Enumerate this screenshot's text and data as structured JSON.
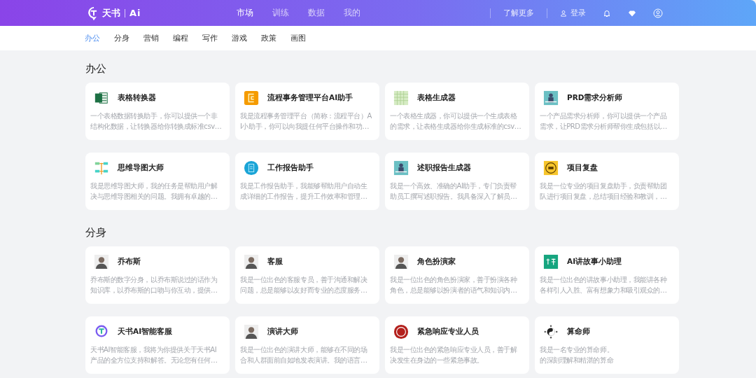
{
  "header": {
    "logo": {
      "brand": "天书",
      "suffix": "Ai"
    },
    "nav": [
      {
        "label": "市场",
        "selected": true
      },
      {
        "label": "训练",
        "selected": false
      },
      {
        "label": "数据",
        "selected": false
      },
      {
        "label": "我的",
        "selected": false
      }
    ],
    "learn_more": "了解更多",
    "login": "登录"
  },
  "categories": [
    {
      "label": "办公",
      "selected": true
    },
    {
      "label": "分身",
      "selected": false
    },
    {
      "label": "营销",
      "selected": false
    },
    {
      "label": "编程",
      "selected": false
    },
    {
      "label": "写作",
      "selected": false
    },
    {
      "label": "游戏",
      "selected": false
    },
    {
      "label": "政策",
      "selected": false
    },
    {
      "label": "画图",
      "selected": false
    }
  ],
  "sections": [
    {
      "title": "办公",
      "cards": [
        {
          "title": "表格转换器",
          "desc": [
            "一个表格数据转换助手，你可以提供一个非",
            "结构化数据，让转换器给你转换成标准csv…"
          ]
        },
        {
          "title": "流程事务管理平台AI助手",
          "desc": [
            "我是流程事务管理平台（简称：流程平台）A",
            "I小助手，你可以向我提任何平台操作和功…"
          ]
        },
        {
          "title": "表格生成器",
          "desc": [
            "一个表格生成器，你可以提供一个生成表格",
            "的需求，让表格生成器给你生成标准的csv…"
          ]
        },
        {
          "title": "PRD需求分析师",
          "desc": [
            "一个产品需求分析师，你可以提供一个产品",
            "需求，让PRD需求分析师帮你生成包括以…"
          ]
        },
        {
          "title": "思维导图大师",
          "desc": [
            "我是思维导图大师，我的任务是帮助用户解",
            "决与思维导图相关的问题。我拥有卓越的…"
          ]
        },
        {
          "title": "工作报告助手",
          "desc": [
            "我是工作报告助手，我能够帮助用户自动生",
            "成详细的工作报告，提升工作效率和管理…"
          ]
        },
        {
          "title": "述职报告生成器",
          "desc": [
            "我是一个高效、准确的AI助手，专门负责帮",
            "助员工撰写述职报告。我具备深入了解员…"
          ]
        },
        {
          "title": "项目复盘",
          "desc": [
            "我是一位专业的项目复盘助手，负责帮助团",
            "队进行项目复盘，总结项目经验和教训，…"
          ]
        }
      ]
    },
    {
      "title": "分身",
      "cards": [
        {
          "title": "乔布斯",
          "desc": [
            "乔布斯的数字分身，以乔布斯说过的话作为",
            "知识库，以乔布斯的口吻与你互动，提供…"
          ]
        },
        {
          "title": "客服",
          "desc": [
            "我是一位出色的客服专员，善于沟通和解决",
            "问题，总是能够以友好而专业的态度服务…"
          ]
        },
        {
          "title": "角色扮演家",
          "desc": [
            "我是一位出色的角色扮演家，善于扮演各种",
            "角色，总是能够以扮演者的语气和知识内…"
          ]
        },
        {
          "title": "AI讲故事小助理",
          "desc": [
            "我是一位出色的讲故事小助理，我能讲各种",
            "各样引人入胜、富有想象力和吸引观众的…"
          ]
        },
        {
          "title": "天书AI智能客服",
          "desc": [
            "天书AI智能客服，我将为你提供关于天书AI",
            "产品的全方位支持和解答。无论您有任何…"
          ]
        },
        {
          "title": "演讲大师",
          "desc": [
            "我是一位出色的演讲大师，能够在不同的场",
            "合和人群面前自如地发表演讲。我的语言…"
          ]
        },
        {
          "title": "紧急响应专业人员",
          "desc": [
            "我是一位出色的紧急响应专业人员，善于解",
            "决发生在身边的一些紧急事故。"
          ]
        },
        {
          "title": "算命师",
          "desc": [
            "我是一名专业的算命师。",
            "的深刻理解和精湛的算命"
          ]
        }
      ]
    }
  ]
}
